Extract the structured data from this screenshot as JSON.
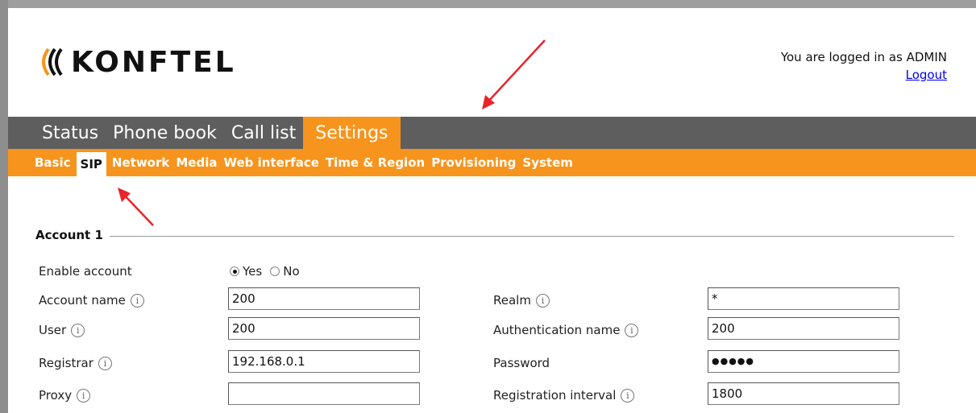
{
  "header": {
    "logo_text": "KONFTEL",
    "login_text": "You are logged in as ADMIN",
    "logout_label": "Logout"
  },
  "main_nav": {
    "tabs": [
      {
        "label": "Status"
      },
      {
        "label": "Phone book"
      },
      {
        "label": "Call list"
      },
      {
        "label": "Settings"
      }
    ],
    "active": "Settings"
  },
  "sub_nav": {
    "tabs": [
      {
        "label": "Basic"
      },
      {
        "label": "SIP"
      },
      {
        "label": "Network"
      },
      {
        "label": "Media"
      },
      {
        "label": "Web interface"
      },
      {
        "label": "Time & Region"
      },
      {
        "label": "Provisioning"
      },
      {
        "label": "System"
      }
    ],
    "active": "SIP"
  },
  "account": {
    "legend": "Account 1",
    "enable_label": "Enable account",
    "enable_yes": "Yes",
    "enable_no": "No",
    "enable_value": "Yes",
    "fields": {
      "account_name": {
        "label": "Account name",
        "value": "200"
      },
      "user": {
        "label": "User",
        "value": "200"
      },
      "registrar": {
        "label": "Registrar",
        "value": "192.168.0.1"
      },
      "proxy": {
        "label": "Proxy",
        "value": ""
      },
      "realm": {
        "label": "Realm",
        "value": "*"
      },
      "auth_name": {
        "label": "Authentication name",
        "value": "200"
      },
      "password": {
        "label": "Password",
        "value": "●●●●●"
      },
      "reg_interval": {
        "label": "Registration interval",
        "value": "1800"
      }
    }
  },
  "colors": {
    "accent": "#f7941d",
    "nav_bg": "#5e5e5e",
    "annotation_arrow": "#e8242a",
    "logo_orange": "#f7941d"
  },
  "icons": {
    "info": "info-icon",
    "logo_wave": "konftel-wave-icon"
  }
}
